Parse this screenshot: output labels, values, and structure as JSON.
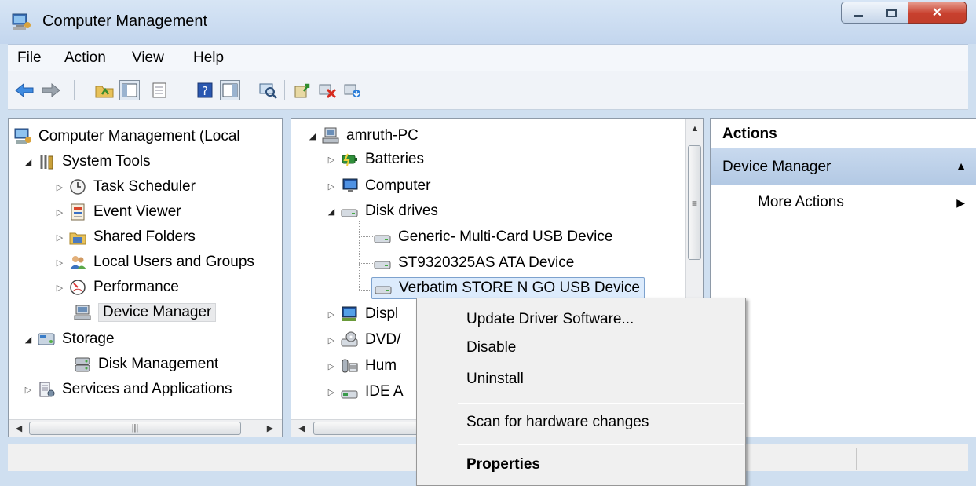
{
  "window": {
    "title": "Computer Management"
  },
  "menu": [
    "File",
    "Action",
    "View",
    "Help"
  ],
  "toolbar": {
    "icons": [
      "back-icon",
      "forward-icon",
      "up-folder-icon",
      "show-hide-console-tree-icon",
      "export-list-icon",
      "help-icon",
      "show-hide-action-pane-icon",
      "scan-hardware-icon",
      "update-driver-icon",
      "disable-device-icon",
      "uninstall-device-icon"
    ]
  },
  "left_tree": {
    "root": "Computer Management (Local",
    "system_tools": "System Tools",
    "task_scheduler": "Task Scheduler",
    "event_viewer": "Event Viewer",
    "shared_folders": "Shared Folders",
    "local_users": "Local Users and Groups",
    "performance": "Performance",
    "device_manager": "Device Manager",
    "storage": "Storage",
    "disk_management": "Disk Management",
    "services": "Services and Applications"
  },
  "device_tree": {
    "computer": "amruth-PC",
    "batteries": "Batteries",
    "computer_node": "Computer",
    "disk_drives": "Disk drives",
    "disk1": "Generic- Multi-Card USB Device",
    "disk2": "ST9320325AS ATA Device",
    "disk3": "Verbatim STORE N GO USB Device",
    "display": "Displ",
    "dvd": "DVD/",
    "human": "Hum",
    "ide": "IDE A"
  },
  "actions_pane": {
    "header": "Actions",
    "section": "Device Manager",
    "more_actions": "More Actions"
  },
  "context_menu": {
    "update": "Update Driver Software...",
    "disable": "Disable",
    "uninstall": "Uninstall",
    "scan": "Scan for hardware changes",
    "properties": "Properties"
  },
  "colors": {
    "selection": "#dcebfc",
    "actions_section": "#c3d5ec",
    "close_button": "#c8402e"
  }
}
